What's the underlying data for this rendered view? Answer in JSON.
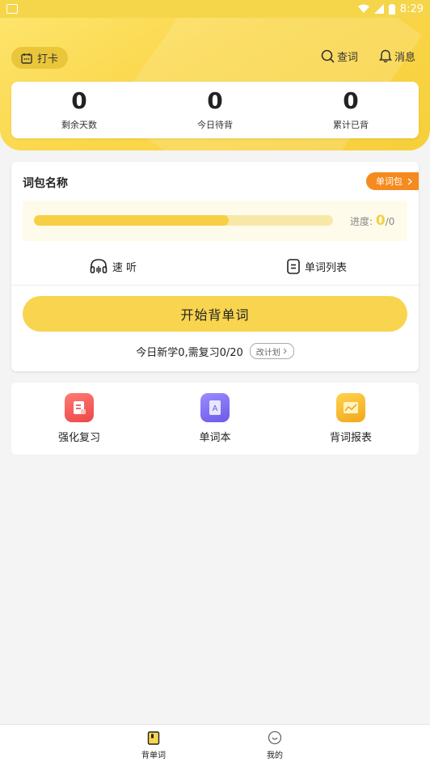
{
  "status_bar": {
    "time": "8:29"
  },
  "header": {
    "clock_in_label": "打卡",
    "search_label": "查词",
    "messages_label": "消息"
  },
  "stats": [
    {
      "value": "0",
      "label": "剩余天数"
    },
    {
      "value": "0",
      "label": "今日待背"
    },
    {
      "value": "0",
      "label": "累计已背"
    }
  ],
  "word_pack": {
    "name": "词包名称",
    "badge_label": "单词包",
    "progress_label": "进度:",
    "progress_current": "0",
    "progress_total": "/0",
    "progress_fraction": 0.65
  },
  "modes": {
    "quick_listen": "速 听",
    "word_list": "单词列表"
  },
  "start_button": "开始背单词",
  "plan": {
    "summary": "今日新学0,需复习0/20",
    "change_plan": "改计划"
  },
  "tools": [
    {
      "label": "强化复习",
      "color": "#f05a5a"
    },
    {
      "label": "单词本",
      "color": "#7b6cf0"
    },
    {
      "label": "背词报表",
      "color": "#f7b32b"
    }
  ],
  "bottom_nav": [
    {
      "label": "背单词",
      "active": true
    },
    {
      "label": "我的",
      "active": false
    }
  ]
}
